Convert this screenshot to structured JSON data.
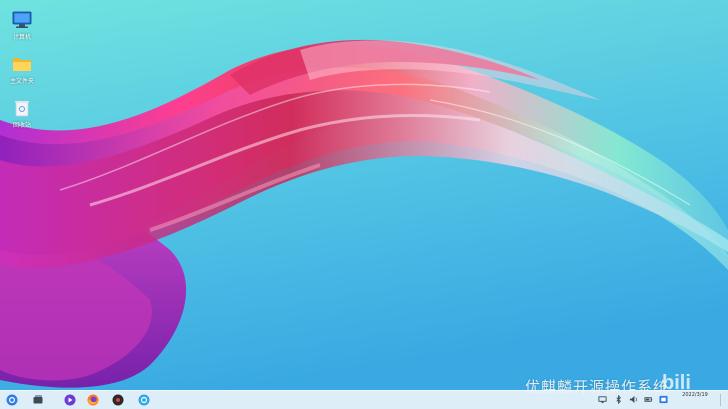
{
  "desktop": {
    "icons": [
      {
        "label": "计算机",
        "icon": "computer-icon"
      },
      {
        "label": "主文件夹",
        "icon": "folder-icon"
      },
      {
        "label": "回收站",
        "icon": "trash-icon"
      }
    ],
    "watermark": "优麒麟开源操作系统",
    "watermark_logo": "bili"
  },
  "taskbar": {
    "apps": [
      {
        "name": "start-menu-icon"
      },
      {
        "name": "multitask-view-icon"
      },
      {
        "name": "video-player-icon"
      },
      {
        "name": "firefox-icon"
      },
      {
        "name": "music-app-icon"
      },
      {
        "name": "software-store-icon"
      }
    ],
    "tray": [
      {
        "name": "network-icon"
      },
      {
        "name": "bluetooth-icon"
      },
      {
        "name": "volume-icon"
      },
      {
        "name": "battery-icon"
      },
      {
        "name": "input-method-icon"
      }
    ],
    "clock": {
      "time": "",
      "date": "2022/3/19"
    }
  },
  "colors": {
    "sky_top": "#6fe3df",
    "sky_bottom": "#3aa9e3",
    "wave_pink": "#ff3f8f",
    "wave_purple": "#b02fd4",
    "wave_red": "#e2424c",
    "wave_teal": "#83e8d2"
  }
}
